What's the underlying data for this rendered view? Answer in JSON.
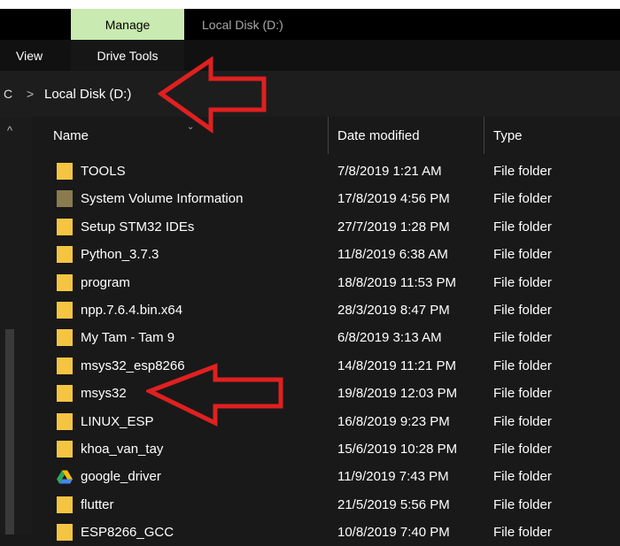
{
  "ribbon": {
    "manage_tab": "Manage",
    "window_title": "Local Disk (D:)",
    "view_tab": "View",
    "drive_tools_tab": "Drive Tools"
  },
  "address_bar": {
    "prefix": "C",
    "separator": ">",
    "path": "Local Disk (D:)"
  },
  "columns": {
    "name": "Name",
    "date_modified": "Date modified",
    "type": "Type"
  },
  "files": [
    {
      "name": "TOOLS",
      "date": "7/8/2019 1:21 AM",
      "type": "File folder",
      "icon": "folder-icon"
    },
    {
      "name": "System Volume Information",
      "date": "17/8/2019 4:56 PM",
      "type": "File folder",
      "icon": "system-folder-icon"
    },
    {
      "name": "Setup STM32 IDEs",
      "date": "27/7/2019 1:28 PM",
      "type": "File folder",
      "icon": "folder-icon"
    },
    {
      "name": "Python_3.7.3",
      "date": "11/8/2019 6:38 AM",
      "type": "File folder",
      "icon": "folder-icon"
    },
    {
      "name": "program",
      "date": "18/8/2019 11:53 PM",
      "type": "File folder",
      "icon": "folder-icon"
    },
    {
      "name": "npp.7.6.4.bin.x64",
      "date": "28/3/2019 8:47 PM",
      "type": "File folder",
      "icon": "folder-icon"
    },
    {
      "name": "My Tam - Tam 9",
      "date": "6/8/2019 3:13 AM",
      "type": "File folder",
      "icon": "folder-icon"
    },
    {
      "name": "msys32_esp8266",
      "date": "14/8/2019 11:21 PM",
      "type": "File folder",
      "icon": "folder-icon"
    },
    {
      "name": "msys32",
      "date": "19/8/2019 12:03 PM",
      "type": "File folder",
      "icon": "folder-icon"
    },
    {
      "name": "LINUX_ESP",
      "date": "16/8/2019 9:23 PM",
      "type": "File folder",
      "icon": "folder-icon"
    },
    {
      "name": "khoa_van_tay",
      "date": "15/6/2019 10:28 PM",
      "type": "File folder",
      "icon": "folder-icon"
    },
    {
      "name": "google_driver",
      "date": "11/9/2019 7:43 PM",
      "type": "File folder",
      "icon": "google-drive-icon"
    },
    {
      "name": "flutter",
      "date": "21/5/2019 5:56 PM",
      "type": "File folder",
      "icon": "folder-icon"
    },
    {
      "name": "ESP8266_GCC",
      "date": "10/8/2019 7:40 PM",
      "type": "File folder",
      "icon": "folder-icon"
    }
  ],
  "colors": {
    "manage_tab_bg": "#c9eab0",
    "annotation_red": "#e02020",
    "folder_yellow": "#f5c542"
  }
}
